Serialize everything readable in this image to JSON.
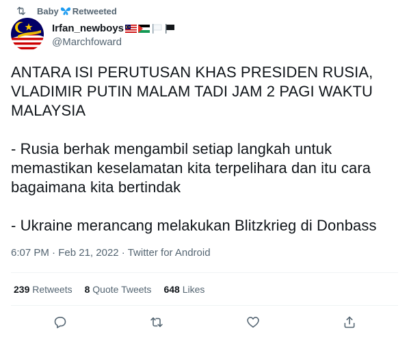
{
  "retweet": {
    "label_prefix": "Baby",
    "label_suffix": "Retweeted"
  },
  "author": {
    "display_name": "Irfan_newboys",
    "handle": "@Marchfoward"
  },
  "tweet": {
    "text": "ANTARA ISI PERUTUSAN KHAS PRESIDEN RUSIA,\nVLADIMIR PUTIN MALAM TADI JAM 2 PAGI WAKTU\nMALAYSIA\n\n- Rusia berhak mengambil setiap langkah untuk\nmemastikan keselamatan kita terpelihara dan itu cara\nbagaimana kita bertindak\n\n- Ukraine merancang melakukan Blitzkrieg di Donbass"
  },
  "meta": {
    "time": "6:07 PM",
    "sep1": " · ",
    "date": "Feb 21, 2022",
    "sep2": " · ",
    "source": "Twitter for Android"
  },
  "stats": {
    "retweets_count": "239",
    "retweets_label": "Retweets",
    "quotes_count": "8",
    "quotes_label": "Quote Tweets",
    "likes_count": "648",
    "likes_label": "Likes"
  },
  "colors": {
    "secondary_text": "#536471",
    "divider": "#eff3f4",
    "butterfly": "#1d9bf0"
  },
  "icons": [
    "retweet-icon",
    "butterfly-icon",
    "malaysia-flag-icon",
    "palestine-flag-icon",
    "white-flag-icon",
    "black-flag-icon",
    "reply-icon",
    "retweet-icon",
    "like-icon",
    "share-icon"
  ]
}
